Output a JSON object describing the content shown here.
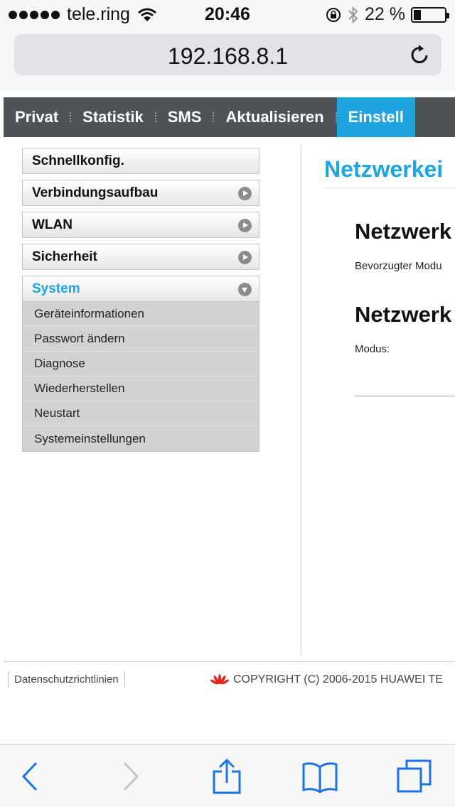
{
  "status_bar": {
    "carrier": "tele.ring",
    "time": "20:46",
    "battery": "22 %",
    "battery_level": 0.22,
    "icons": [
      "signal-dots",
      "wifi-icon",
      "orientation-lock-icon",
      "bluetooth-icon",
      "battery-icon"
    ]
  },
  "address_bar": {
    "url": "192.168.8.1",
    "reload_icon": "reload-icon"
  },
  "main_nav": {
    "items": [
      {
        "label": "Privat",
        "active": false
      },
      {
        "label": "Statistik",
        "active": false
      },
      {
        "label": "SMS",
        "active": false
      },
      {
        "label": "Aktualisieren",
        "active": false
      },
      {
        "label": "Einstell",
        "active": true
      }
    ],
    "active_color": "#1ea5e0",
    "bar_color": "#4d5356"
  },
  "sidebar": {
    "items": [
      {
        "label": "Schnellkonfig."
      },
      {
        "label": "Verbindungsaufbau"
      },
      {
        "label": "WLAN"
      },
      {
        "label": "Sicherheit"
      },
      {
        "label": "System"
      }
    ],
    "submenu": [
      {
        "label": "Geräteinformationen"
      },
      {
        "label": "Passwort ändern"
      },
      {
        "label": "Diagnose"
      },
      {
        "label": "Wiederherstellen"
      },
      {
        "label": "Neustart"
      },
      {
        "label": "Systemeinstellungen"
      }
    ]
  },
  "content": {
    "title": "Netzwerkei",
    "section1_title": "Netzwerk",
    "section1_label": "Bevorzugter Modu",
    "section2_title": "Netzwerk",
    "section2_label": "Modus:"
  },
  "footer": {
    "link": "Datenschutzrichtlinien",
    "copyright": "COPYRIGHT (C) 2006-2015 HUAWEI TE"
  },
  "toolbar": {
    "icons": [
      "back-icon",
      "forward-icon",
      "share-icon",
      "bookmarks-icon",
      "tabs-icon"
    ],
    "accent": "#1a73e8"
  }
}
